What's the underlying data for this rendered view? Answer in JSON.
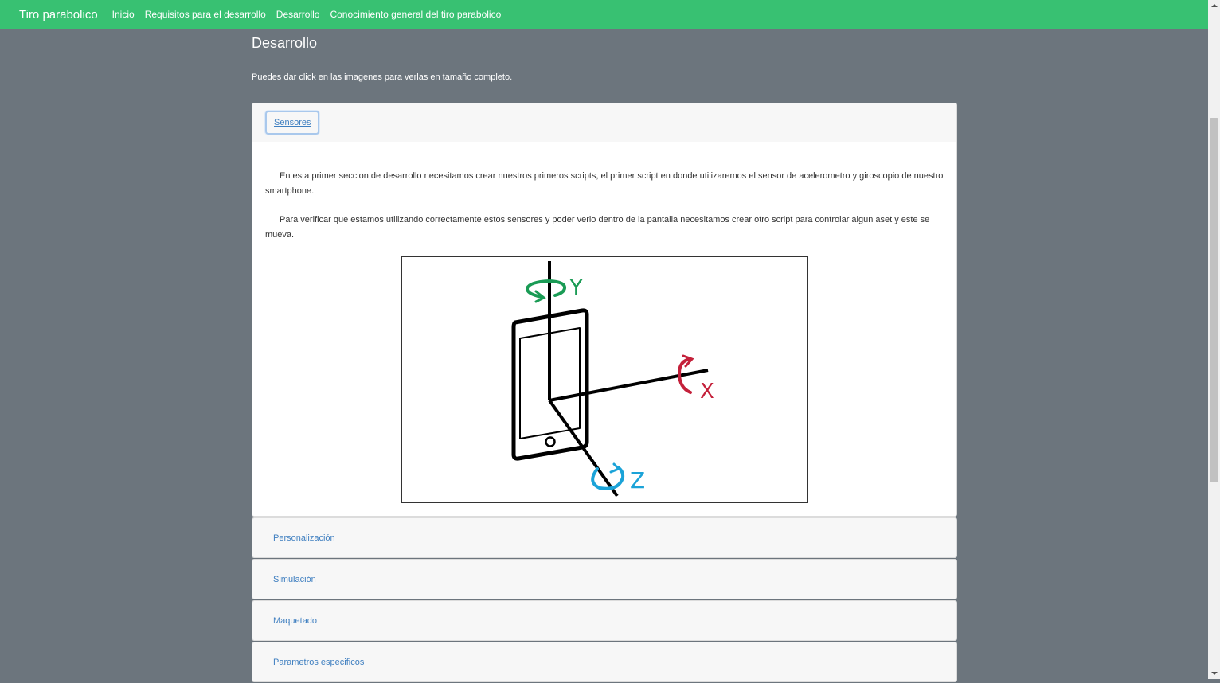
{
  "navbar": {
    "brand": "Tiro parabolico",
    "links": [
      "Inicio",
      "Requisitos para el desarrollo",
      "Desarrollo",
      "Conocimiento general del tiro parabolico"
    ]
  },
  "page": {
    "title": "Desarrollo",
    "intro": "Puedes dar click en las imagenes para verlas en tamaño completo."
  },
  "accordion": {
    "sections": [
      {
        "label": "Sensores",
        "paragraphs": [
          "En esta primer seccion de desarrollo necesitamos crear nuestros primeros scripts, el primer script en donde utilizaremos el sensor de acelerometro y giroscopio de nuestro smartphone.",
          "Para verificar que estamos utilizando correctamente estos sensores y poder verlo dentro de la pantalla necesitamos crear otro script para controlar algun aset y este se mueva."
        ],
        "figure": {
          "axis_y": "Y",
          "axis_x": "X",
          "axis_z": "Z",
          "color_y": "#1a9b55",
          "color_x": "#c4203a",
          "color_z": "#1ba3d8"
        }
      },
      {
        "label": "Personalización"
      },
      {
        "label": "Simulación"
      },
      {
        "label": "Maquetado"
      },
      {
        "label": "Parametros especificos"
      }
    ]
  }
}
